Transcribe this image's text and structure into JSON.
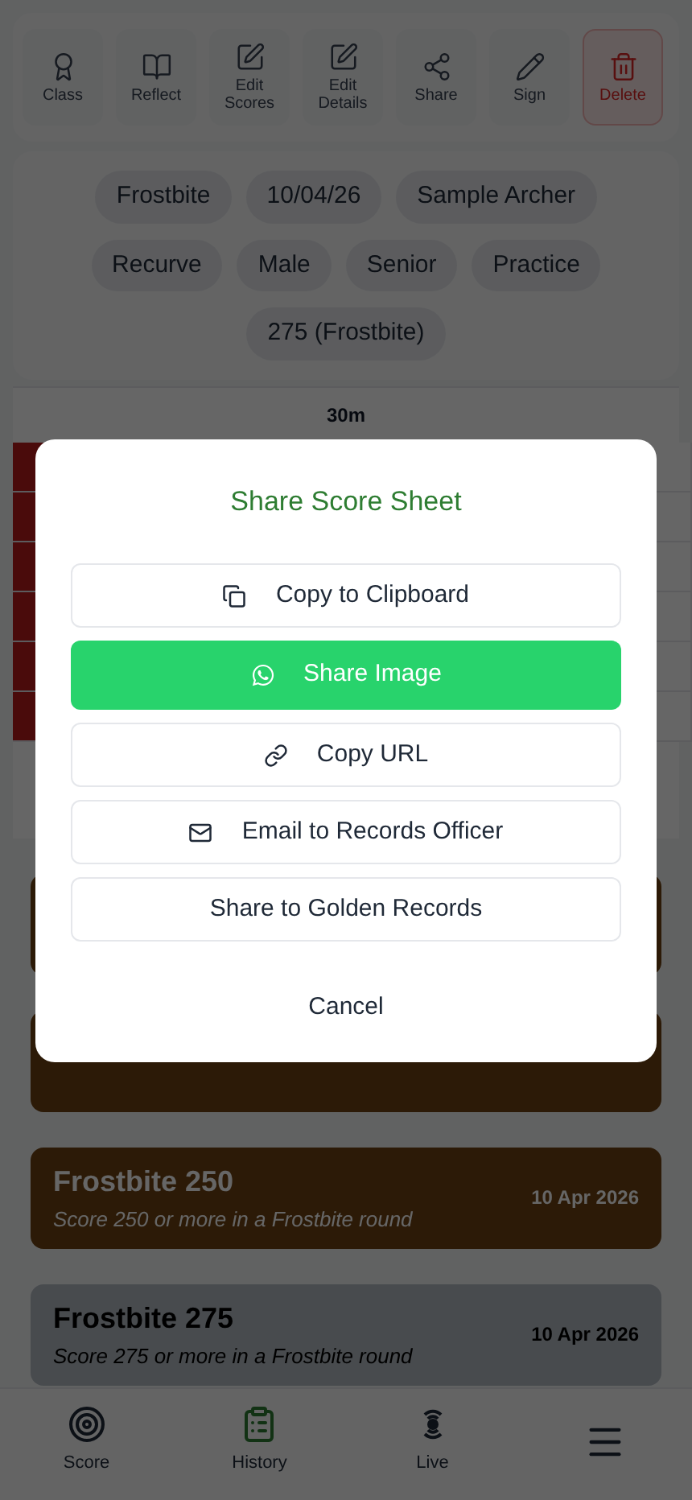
{
  "toolbar": [
    {
      "label": "Class",
      "kind": "normal"
    },
    {
      "label": "Reflect",
      "kind": "normal"
    },
    {
      "label": "Edit\nScores",
      "kind": "normal"
    },
    {
      "label": "Edit\nDetails",
      "kind": "normal"
    },
    {
      "label": "Share",
      "kind": "normal"
    },
    {
      "label": "Sign",
      "kind": "normal"
    },
    {
      "label": "Delete",
      "kind": "danger"
    }
  ],
  "details": [
    [
      "Frostbite",
      "10/04/26",
      "Sample Archer"
    ],
    [
      "Recurve",
      "Male",
      "Senior",
      "Practice"
    ],
    [
      "275 (Frostbite)"
    ]
  ],
  "score_table": {
    "heading": "30m"
  },
  "awards": [
    {
      "kind": "bronze"
    },
    {
      "kind": "bronze"
    },
    {
      "title": "Frostbite 250",
      "description": "Score 250 or more in a Frostbite round",
      "date": "10 Apr 2026",
      "kind": "bronze"
    },
    {
      "title": "Frostbite 275",
      "description": "Score 275 or more in a Frostbite round",
      "date": "10 Apr 2026",
      "kind": "silver"
    }
  ],
  "dialog": {
    "title": "Share Score Sheet",
    "options": [
      {
        "label": "Copy to Clipboard",
        "kind": "plain"
      },
      {
        "label": "Share Image",
        "kind": "primary"
      },
      {
        "label": "Copy URL",
        "kind": "plain"
      },
      {
        "label": "Email to Records Officer",
        "kind": "plain"
      },
      {
        "label": "Share to Golden Records",
        "kind": "plain"
      }
    ],
    "cancel": "Cancel"
  },
  "nav": [
    {
      "label": "Score",
      "selected": false
    },
    {
      "label": "History",
      "selected": true
    },
    {
      "label": "Live",
      "selected": false
    },
    {
      "selected": false
    }
  ]
}
